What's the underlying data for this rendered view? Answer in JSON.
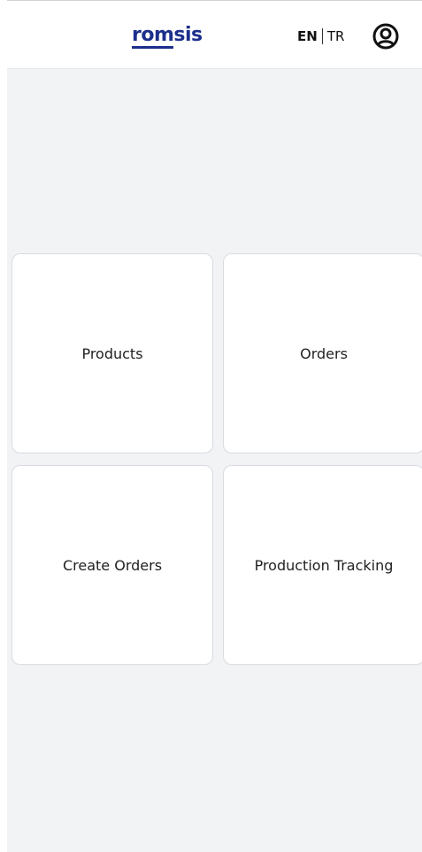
{
  "header": {
    "logo": {
      "underlined_part": "rom",
      "rest": "sis"
    },
    "language": {
      "active": "EN",
      "other": "TR"
    },
    "user_icon": "user-circle-icon"
  },
  "menu": {
    "items": [
      {
        "label": "Products"
      },
      {
        "label": "Orders"
      },
      {
        "label": "Create Orders"
      },
      {
        "label": "Production Tracking"
      }
    ]
  },
  "colors": {
    "brand": "#1d2f8c",
    "background": "#f2f3f5",
    "card": "#ffffff",
    "card_border": "#d8dbe0"
  }
}
